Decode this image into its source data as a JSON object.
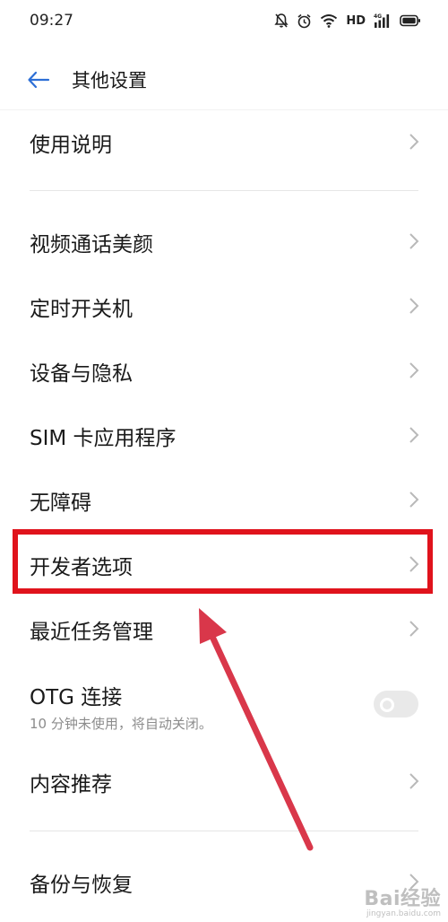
{
  "status_bar": {
    "time": "09:27",
    "network_label": "HD",
    "icons": [
      "mute-bell-icon",
      "alarm-icon",
      "wifi-icon",
      "4g-signal-icon",
      "battery-icon"
    ]
  },
  "header": {
    "back_icon": "back-arrow-icon",
    "title": "其他设置"
  },
  "items": [
    {
      "label": "使用说明"
    },
    {
      "label": "视频通话美颜"
    },
    {
      "label": "定时开关机"
    },
    {
      "label": "设备与隐私"
    },
    {
      "label": "SIM 卡应用程序"
    },
    {
      "label": "无障碍"
    },
    {
      "label": "开发者选项"
    },
    {
      "label": "最近任务管理"
    },
    {
      "label": "OTG 连接",
      "subtitle": "10 分钟未使用，将自动关闭。",
      "toggle_on": false
    },
    {
      "label": "内容推荐"
    },
    {
      "label": "备份与恢复"
    }
  ],
  "annotation": {
    "highlighted_item": "开发者选项",
    "highlight_color": "#e0131c",
    "arrow_color": "#d9374a"
  },
  "watermark": {
    "logo": "Bai经验",
    "url": "jingyan.baidu.com"
  }
}
